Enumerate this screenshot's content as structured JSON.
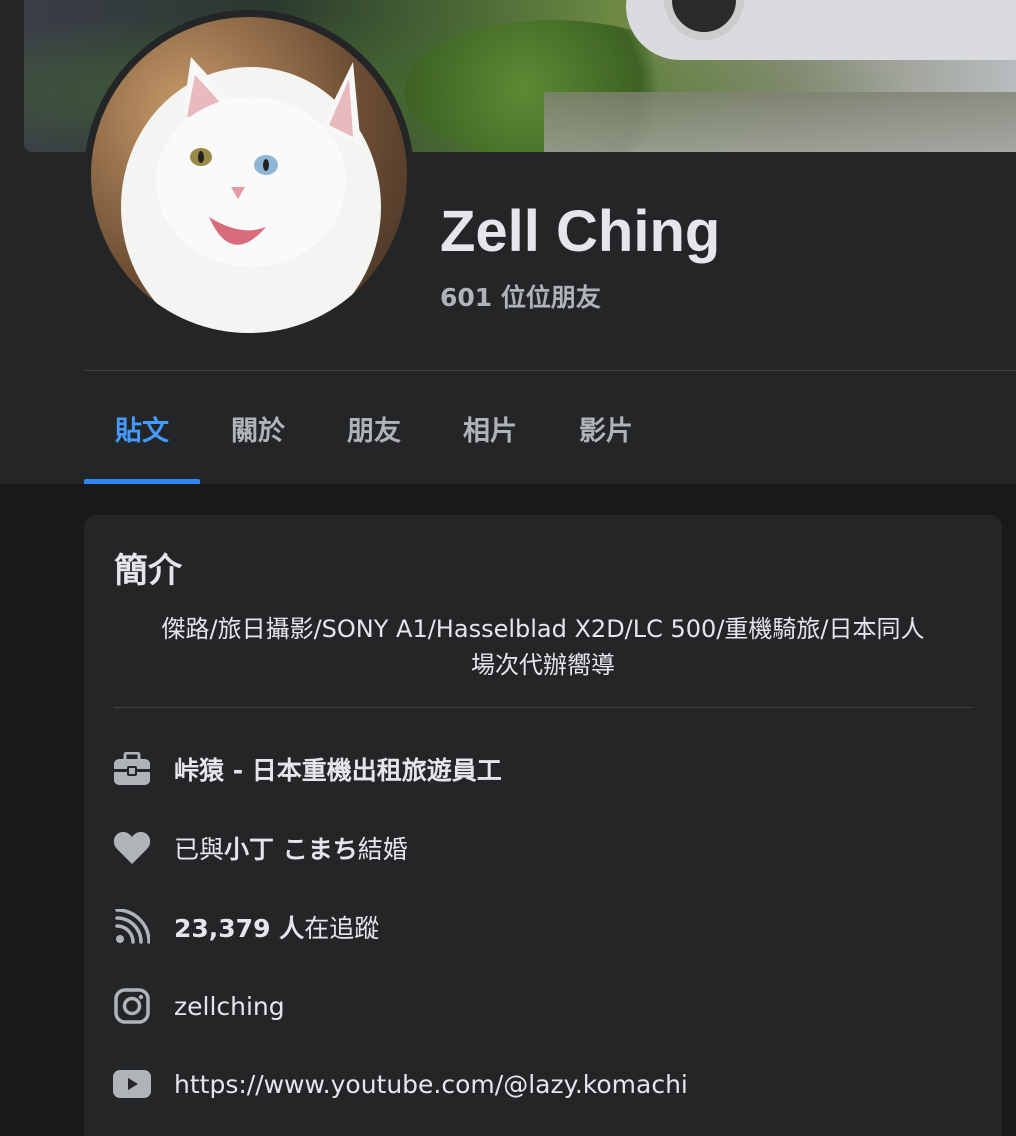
{
  "profile": {
    "name": "Zell Ching",
    "friends_count": "601 位位朋友"
  },
  "tabs": [
    {
      "label": "貼文",
      "active": true
    },
    {
      "label": "關於",
      "active": false
    },
    {
      "label": "朋友",
      "active": false
    },
    {
      "label": "相片",
      "active": false
    },
    {
      "label": "影片",
      "active": false
    }
  ],
  "intro": {
    "title": "簡介",
    "bio_line1": "傑路/旅日攝影/SONY A1/Hasselblad X2D/LC 500/重機騎旅/日本同人",
    "bio_line2": "場次代辦嚮導",
    "work": "峠猿 - 日本重機出租旅遊員工",
    "relationship_prefix": "已與",
    "relationship_partner": "小丁 こまち",
    "relationship_suffix": "結婚",
    "followers_count": "23,379 人",
    "followers_suffix": "在追蹤",
    "instagram": "zellching",
    "youtube": "https://www.youtube.com/@lazy.komachi"
  },
  "icons": {
    "work": "briefcase-icon",
    "relationship": "heart-icon",
    "followers": "rss-icon",
    "instagram": "instagram-icon",
    "youtube": "youtube-icon"
  },
  "colors": {
    "background": "#18191a",
    "surface": "#242526",
    "text_primary": "#e4e6eb",
    "text_secondary": "#b0b3b8",
    "accent": "#2d88ff",
    "link": "#4599ff"
  }
}
